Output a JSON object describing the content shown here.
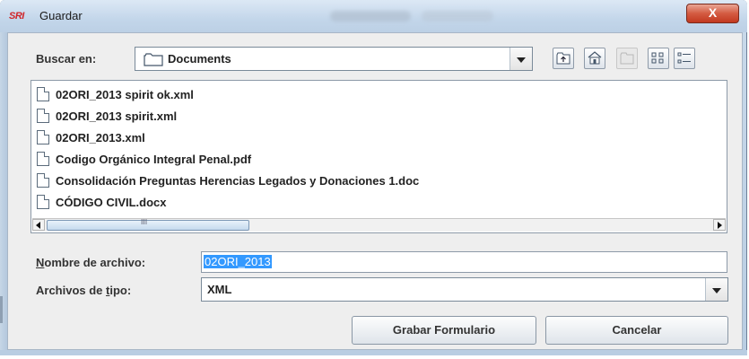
{
  "window": {
    "logo_text": "SRI",
    "title": "Guardar",
    "close_label": "X"
  },
  "lookin": {
    "label": "Buscar en:",
    "value": "Documents"
  },
  "toolbar": {
    "icons": [
      "up-folder-icon",
      "home-icon",
      "new-folder-icon",
      "list-view-icon",
      "details-view-icon"
    ]
  },
  "files": [
    "02ORI_2013 spirit ok.xml",
    "02ORI_2013 spirit.xml",
    "02ORI_2013.xml",
    "Codigo Orgánico Integral Penal.pdf",
    "Consolidación Preguntas Herencias Legados y Donaciones 1.doc",
    "CÓDIGO CIVIL.docx"
  ],
  "filename": {
    "label_accel": "N",
    "label_rest": "ombre de archivo:",
    "value": "02ORI_2013"
  },
  "filetype": {
    "label_pre": "Archivos de ",
    "label_accel": "t",
    "label_post": "ipo:",
    "value": "XML"
  },
  "buttons": {
    "save": "Grabar Formulario",
    "cancel": "Cancelar"
  },
  "scroll": {
    "thumb_glyph": "III"
  },
  "colors": {
    "selection": "#3399ff",
    "close": "#c1391f"
  }
}
